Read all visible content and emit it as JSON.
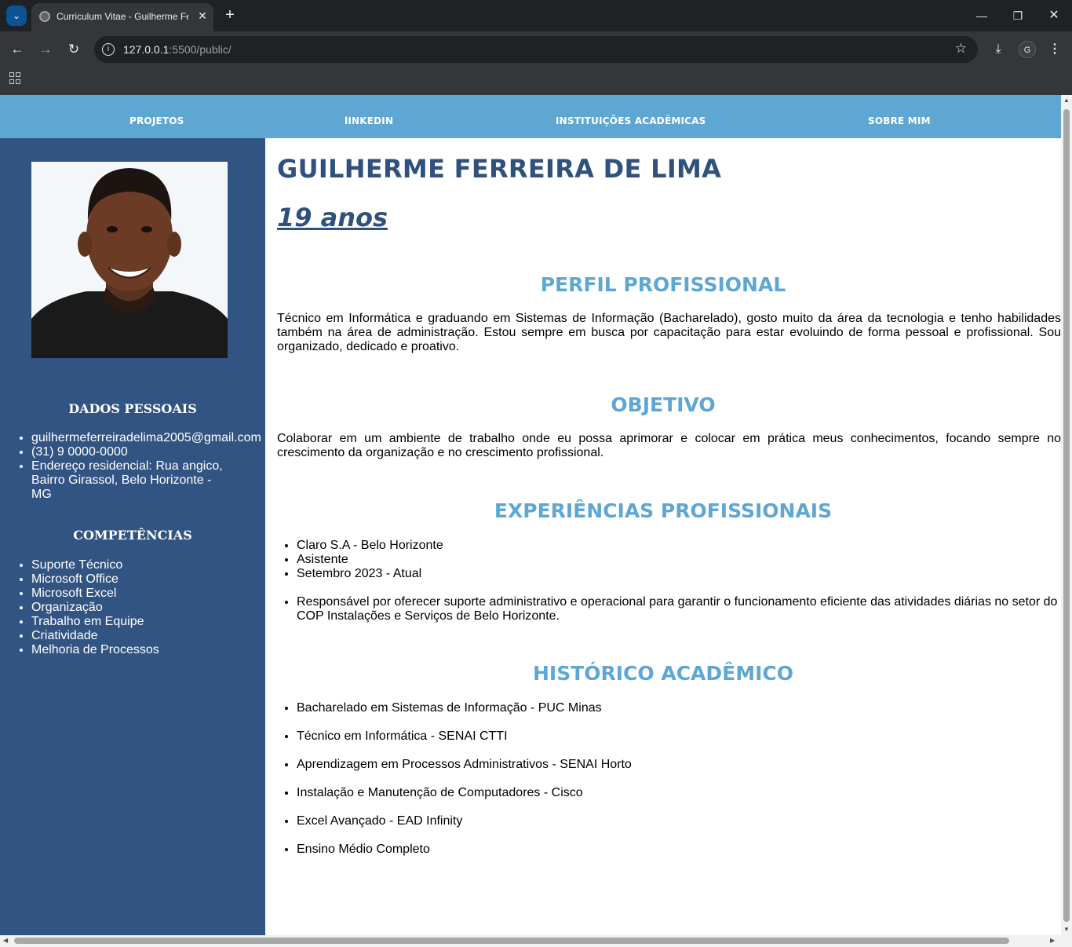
{
  "browser": {
    "tab_title": "Curriculum Vitae - Guilherme Fe",
    "url_host": "127.0.0.1",
    "url_path": ":5500/public/",
    "profile_initial": "G"
  },
  "nav": {
    "items": [
      "PROJETOS",
      "lINKEDIN",
      "INSTITUIÇÕES ACADÊMICAS",
      "SOBRE MIM"
    ]
  },
  "sidebar": {
    "personal_heading": "DADOS PESSOAIS",
    "personal_items": [
      "guilhermeferreiradelima2005@gmail.com",
      "(31) 9 0000-0000",
      "Endereço residencial: Rua angico, Bairro Girassol, Belo Horizonte - MG"
    ],
    "skills_heading": "COMPETÊNCIAS",
    "skills": [
      "Suporte Técnico",
      "Microsoft Office",
      "Microsoft Excel",
      "Organização",
      "Trabalho em Equipe",
      "Criatividade",
      "Melhoria de Processos"
    ]
  },
  "main": {
    "name": "GUILHERME FERREIRA DE LIMA",
    "age": "19 anos",
    "profile_heading": "PERFIL PROFISSIONAL",
    "profile_text": "Técnico em Informática e graduando em Sistemas de Informação (Bacharelado), gosto muito da área da tecnologia e tenho habilidades também na área de administração. Estou sempre em busca por capacitação para estar evoluindo de forma pessoal e profissional. Sou organizado, dedicado e proativo.",
    "objective_heading": "OBJETIVO",
    "objective_text": "Colaborar em um ambiente de trabalho onde eu possa aprimorar e colocar em prática meus conhecimentos, focando sempre no crescimento da organização e no crescimento profissional.",
    "experience_heading": "EXPERIÊNCIAS PROFISSIONAIS",
    "experience_items": [
      "Claro S.A - Belo Horizonte",
      "Asistente",
      "Setembro 2023 - Atual"
    ],
    "experience_desc": "Responsável por oferecer suporte administrativo e operacional para garantir o funcionamento eficiente das atividades diárias no setor do COP Instalações e Serviços de Belo Horizonte.",
    "academic_heading": "HISTÓRICO ACADÊMICO",
    "academic_items": [
      "Bacharelado em Sistemas de Informação - PUC Minas",
      "Técnico em Informática - SENAI CTTI",
      "Aprendizagem em Processos Administrativos - SENAI Horto",
      "Instalação e Manutenção de Computadores - Cisco",
      "Excel Avançado - EAD Infinity",
      "Ensino Médio Completo"
    ]
  }
}
